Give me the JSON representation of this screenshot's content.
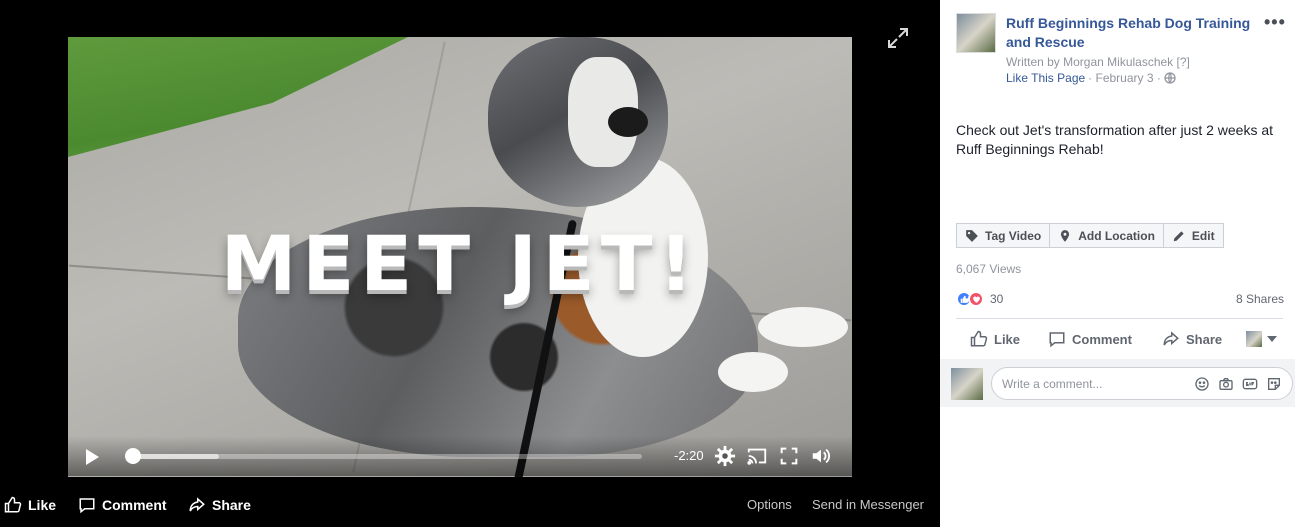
{
  "video": {
    "overlay_title": "MEET JET!",
    "time_remaining": "-2:20",
    "progress_fraction": 0.01,
    "buffered_fraction": 0.18
  },
  "video_actions": {
    "like": "Like",
    "comment": "Comment",
    "share": "Share",
    "options": "Options",
    "send_messenger": "Send in Messenger"
  },
  "post": {
    "page_name": "Ruff Beginnings Rehab Dog Training and Rescue",
    "written_by": "Written by Morgan Mikulaschek [?]",
    "like_page": "Like This Page",
    "date": "· February 3 ·",
    "text": "Check out Jet's transformation after just 2 weeks at Ruff Beginnings Rehab!",
    "tag_video": "Tag Video",
    "add_location": "Add Location",
    "edit": "Edit",
    "views": "6,067 Views",
    "reaction_count": "30",
    "shares": "8 Shares",
    "like": "Like",
    "comment": "Comment",
    "share": "Share",
    "comment_placeholder": "Write a comment..."
  },
  "colors": {
    "link_blue": "#365899",
    "like_blue": "#4080ff",
    "love_red": "#f25268",
    "video_bg": "#000000"
  },
  "icons": [
    "expand-icon",
    "play-icon",
    "settings-icon",
    "cast-icon",
    "fullscreen-icon",
    "volume-icon",
    "thumbs-up-icon",
    "comment-icon",
    "share-icon",
    "globe-icon",
    "tag-icon",
    "location-pin-icon",
    "pencil-icon",
    "emoji-icon",
    "camera-icon",
    "gif-icon",
    "sticker-icon",
    "more-icon"
  ]
}
